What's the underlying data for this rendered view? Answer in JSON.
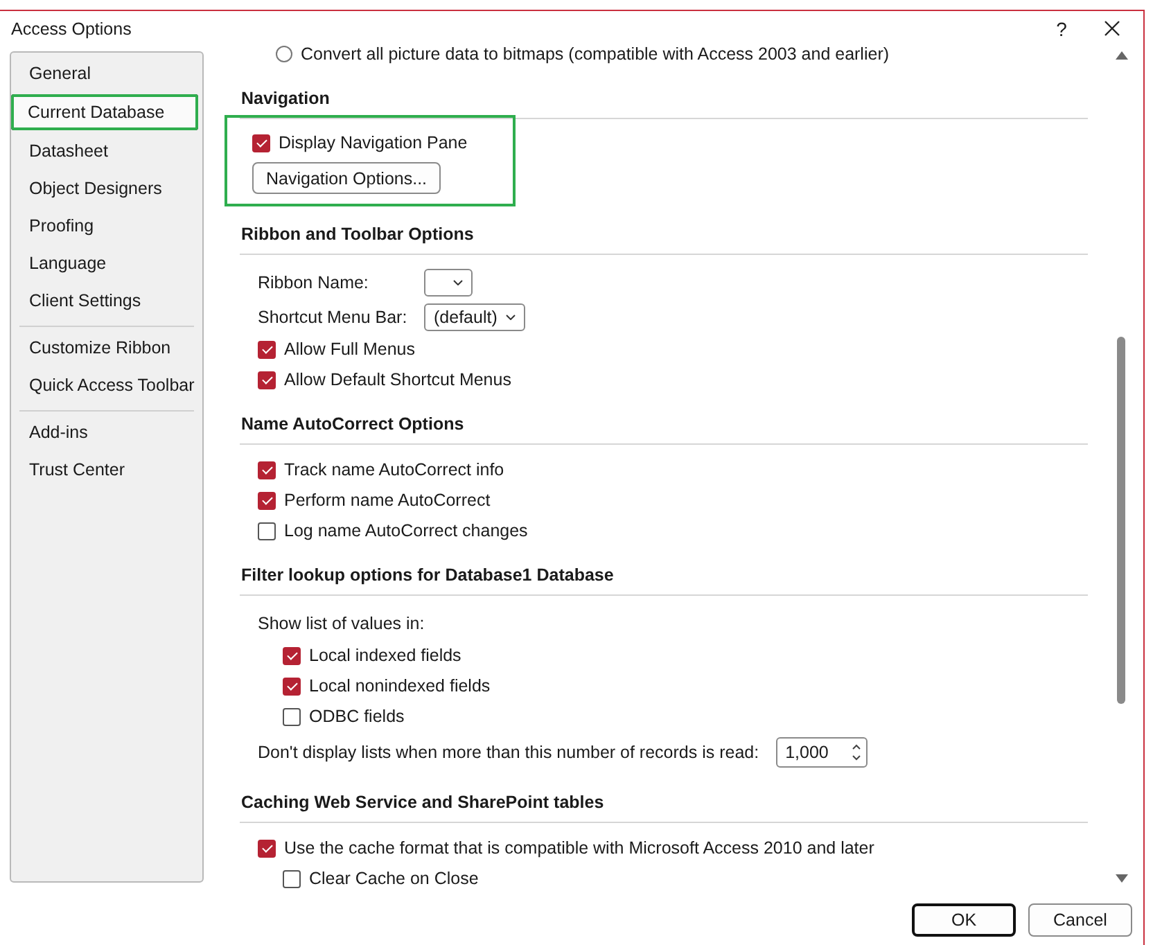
{
  "window": {
    "title": "Access Options",
    "help": "?"
  },
  "sidebar": {
    "groups": [
      {
        "items": [
          {
            "label": "General",
            "selected": false,
            "highlighted": false
          },
          {
            "label": "Current Database",
            "selected": true,
            "highlighted": true
          },
          {
            "label": "Datasheet",
            "selected": false,
            "highlighted": false
          },
          {
            "label": "Object Designers",
            "selected": false,
            "highlighted": false
          },
          {
            "label": "Proofing",
            "selected": false,
            "highlighted": false
          },
          {
            "label": "Language",
            "selected": false,
            "highlighted": false
          },
          {
            "label": "Client Settings",
            "selected": false,
            "highlighted": false
          }
        ]
      },
      {
        "items": [
          {
            "label": "Customize Ribbon",
            "selected": false,
            "highlighted": false
          },
          {
            "label": "Quick Access Toolbar",
            "selected": false,
            "highlighted": false
          }
        ]
      },
      {
        "items": [
          {
            "label": "Add-ins",
            "selected": false,
            "highlighted": false
          },
          {
            "label": "Trust Center",
            "selected": false,
            "highlighted": false
          }
        ]
      }
    ]
  },
  "content": {
    "top_rows": [
      {
        "kind": "radio",
        "label": "Convert all picture data to bitmaps (compatible with Access 2003 and earlier)",
        "selected": false
      }
    ],
    "sections": [
      {
        "title": "Navigation",
        "highlighted": true,
        "rows": [
          {
            "kind": "check",
            "label": "Display Navigation Pane",
            "checked": true
          },
          {
            "kind": "button",
            "label": "Navigation Options..."
          }
        ]
      },
      {
        "title": "Ribbon and Toolbar Options",
        "highlighted": false,
        "rows": [
          {
            "kind": "dropdown",
            "label": "Ribbon Name:",
            "value": ""
          },
          {
            "kind": "dropdown",
            "label": "Shortcut Menu Bar:",
            "value": "(default)"
          },
          {
            "kind": "check",
            "label": "Allow Full Menus",
            "checked": true
          },
          {
            "kind": "check",
            "label": "Allow Default Shortcut Menus",
            "checked": true
          }
        ]
      },
      {
        "title": "Name AutoCorrect Options",
        "highlighted": false,
        "rows": [
          {
            "kind": "check",
            "label": "Track name AutoCorrect info",
            "checked": true
          },
          {
            "kind": "check",
            "label": "Perform name AutoCorrect",
            "checked": true
          },
          {
            "kind": "check",
            "label": "Log name AutoCorrect changes",
            "checked": false
          }
        ]
      },
      {
        "title": "Filter lookup options for Database1 Database",
        "highlighted": false,
        "rows": [
          {
            "kind": "label",
            "label": "Show list of values in:",
            "children": [
              {
                "kind": "check",
                "label": "Local indexed fields",
                "checked": true
              },
              {
                "kind": "check",
                "label": "Local nonindexed fields",
                "checked": true
              },
              {
                "kind": "check",
                "label": "ODBC fields",
                "checked": false
              }
            ]
          },
          {
            "kind": "spinner",
            "label": "Don't display lists when more than this number of records is read:",
            "value": "1,000"
          }
        ]
      },
      {
        "title": "Caching Web Service and SharePoint tables",
        "highlighted": false,
        "rows": [
          {
            "kind": "check",
            "label": "Use the cache format that is compatible with Microsoft Access 2010 and later",
            "checked": true,
            "children": [
              {
                "kind": "check",
                "label": "Clear Cache on Close",
                "checked": false
              }
            ]
          }
        ]
      }
    ]
  },
  "buttons": [
    {
      "label": "OK",
      "default": true
    },
    {
      "label": "Cancel",
      "default": false
    }
  ]
}
